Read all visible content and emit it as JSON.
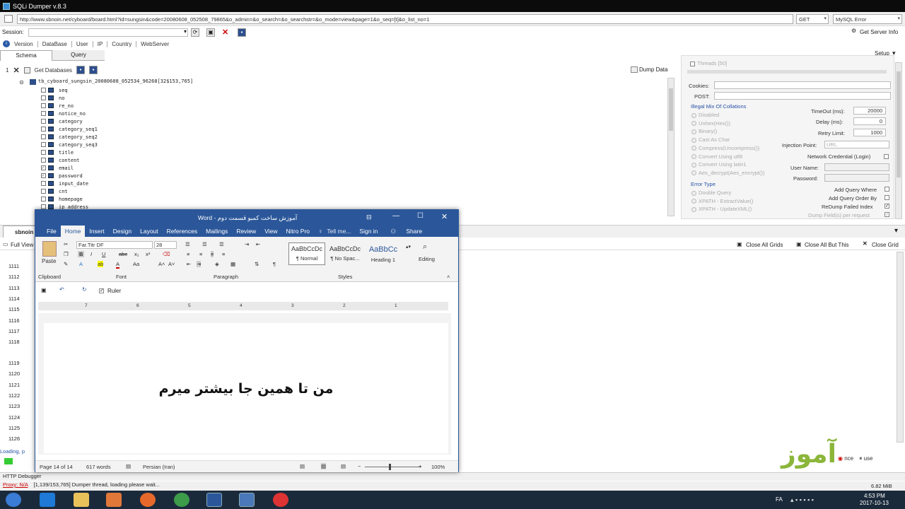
{
  "app": {
    "title": "SQLi Dumper v.8.3"
  },
  "url": {
    "value": "http://www.sbnoin.net/cyboard/board.html?id=sungsin&code=20080608_052508_79865&o_admin=&o_search=&o_searchstr=&o_mode=view&page=1&o_seq=[t]&o_list_no=1",
    "method": "GET",
    "dbms": "MySQL Error"
  },
  "session": {
    "label": "Session:",
    "get_server_info": "Get Server Info"
  },
  "menu": {
    "items": [
      "Version",
      "DataBase",
      "User",
      "IP",
      "Country",
      "WebServer"
    ],
    "setup": "Setup"
  },
  "tabs": {
    "schema": "Schema",
    "query": "Query"
  },
  "treebar": {
    "count": "1",
    "get_databases": "Get Databases",
    "dump_data": "Dump Data"
  },
  "tree": {
    "database": "tb_cyboard_sungsin_20080608_052534_96268[32$153,765]",
    "columns": [
      {
        "name": "seq",
        "checked": false
      },
      {
        "name": "no",
        "checked": false
      },
      {
        "name": "re_no",
        "checked": false
      },
      {
        "name": "notice_no",
        "checked": false
      },
      {
        "name": "category",
        "checked": false
      },
      {
        "name": "category_seq1",
        "checked": false
      },
      {
        "name": "category_seq2",
        "checked": false
      },
      {
        "name": "category_seq3",
        "checked": false
      },
      {
        "name": "title",
        "checked": false
      },
      {
        "name": "content",
        "checked": false
      },
      {
        "name": "email",
        "checked": true
      },
      {
        "name": "password",
        "checked": true
      },
      {
        "name": "input_date",
        "checked": false
      },
      {
        "name": "cnt",
        "checked": false
      },
      {
        "name": "homepage",
        "checked": false
      },
      {
        "name": "ip_address",
        "checked": false
      }
    ]
  },
  "right": {
    "threads": "Threads [50]",
    "cookies": "Cookies:",
    "post": "POST:",
    "collations_title": "Illegal Mix Of Collations",
    "collations": [
      "Disabled",
      "Unhex(Hex())",
      "Binary()",
      "Cast As Char",
      "Compress(Uncompress())",
      "Convert Using utf8",
      "Convert Using latin1",
      "Aes_decrypt(Aes_encrypt())"
    ],
    "error_type_title": "Error Type",
    "error_types": [
      "Double Query",
      "XPATH - ExtractValue()",
      "XPATH - UpdateXML()"
    ],
    "timeout_label": "TimeOut (ms):",
    "timeout": "20000",
    "delay_label": "Delay (ms):",
    "delay": "0",
    "retry_label": "Retry Limit:",
    "retry": "1000",
    "injection_label": "Injection Point:",
    "injection": "URL",
    "netcred": "Network Credential (Login)",
    "username": "User Name:",
    "password": "Password:",
    "add_where": "Add Query Where",
    "add_order": "Add Query Order By",
    "redump": "ReDump Failed Index",
    "dump_fields": "Dump Field(s) per request"
  },
  "grid": {
    "tab": "sbnoin",
    "full_view": "Full View",
    "close_all": "Close All Grids",
    "close_but": "Close All But This",
    "close": "Close Grid",
    "rows": [
      "1111",
      "1112",
      "1113",
      "1114",
      "1115",
      "1116",
      "1117",
      "1118",
      "1119",
      "1120",
      "1121",
      "1122",
      "1123",
      "1124",
      "1125",
      "1126"
    ]
  },
  "status": {
    "loading": "Loading, p",
    "http_debugger": "HTTP Debugger",
    "proxy": "Proxy: N/A",
    "progress": "[1,139/153,765]",
    "message": "Dumper thread, loading please wait...",
    "memory": "6.82 MiB"
  },
  "word": {
    "title": "آموزش ساخت کمبو قسمت دوم - Word",
    "tabs": [
      "File",
      "Home",
      "Insert",
      "Design",
      "Layout",
      "References",
      "Mailings",
      "Review",
      "View",
      "Nitro Pro"
    ],
    "tell_me": "Tell me...",
    "sign_in": "Sign in",
    "share": "Share",
    "paste": "Paste",
    "font_name": "Far.Titr DF",
    "font_size": "28",
    "styles": [
      {
        "preview": "AaBbCcDc",
        "name": "¶ Normal"
      },
      {
        "preview": "AaBbCcDc",
        "name": "¶ No Spac..."
      },
      {
        "preview": "AaBbCc",
        "name": "Heading 1"
      }
    ],
    "editing": "Editing",
    "groups": [
      "Clipboard",
      "Font",
      "Paragraph",
      "Styles"
    ],
    "ruler_label": "Ruler",
    "ruler_numbers": [
      "7",
      "6",
      "5",
      "4",
      "3",
      "2",
      "1"
    ],
    "doc_text": "من تا همین جا بیشتر میرم",
    "page_info": "Page 14 of 14",
    "words": "617 words",
    "language": "Persian (Iran)",
    "zoom": "100%"
  },
  "watermark": {
    "text": "آموز"
  },
  "tray": {
    "lang": "FA",
    "time": "4:53 PM",
    "date": "2017-10-13"
  },
  "overlay": {
    "a": "nce",
    "b": "use"
  }
}
